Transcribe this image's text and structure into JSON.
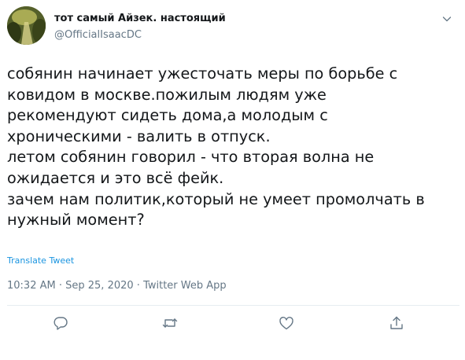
{
  "author": {
    "display_name": "тот самый Айзек. настоящий",
    "handle": "@OfficialIsaacDC"
  },
  "tweet": {
    "lines": [
      "собянин начинает ужесточать меры по борьбе с",
      "ковидом в москве.пожилым людям уже",
      "рекомендуют сидеть дома,а молодым с",
      "хроническими - валить в отпуск.",
      "летом собянин говорил - что вторая волна не",
      "ожидается и это всё фейк.",
      "зачем нам политик,который не умеет промолчать в",
      "нужный момент?"
    ],
    "translate_label": "Translate Tweet"
  },
  "meta": {
    "time": "10:32 AM",
    "separator": " · ",
    "date": "Sep 25, 2020",
    "source": "Twitter Web App"
  },
  "icons": {
    "caret": "chevron-down-icon",
    "reply": "reply-icon",
    "retweet": "retweet-icon",
    "like": "heart-icon",
    "share": "share-icon"
  },
  "colors": {
    "text": "#14171a",
    "secondary": "#657786",
    "link": "#1b95e0",
    "divider": "#e6ecf0"
  }
}
